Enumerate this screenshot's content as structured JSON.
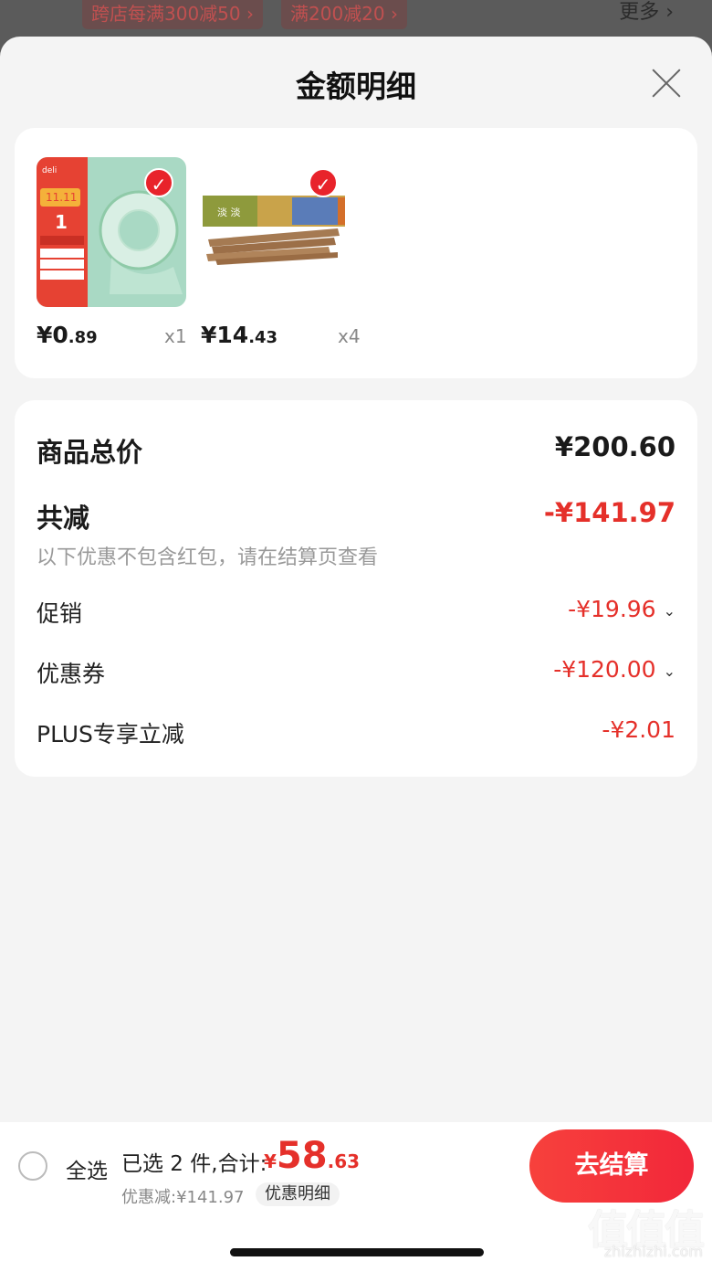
{
  "background": {
    "tags": [
      "跨店每满300减50 ›",
      "满200减20 ›"
    ],
    "more_label": "更多 ›"
  },
  "sheet": {
    "title": "金额明细",
    "close_icon": "close-icon"
  },
  "products": [
    {
      "price_int": "¥0",
      "price_dec": ".89",
      "qty": "x1",
      "selected": true,
      "thumb_icon": "tape-product-image"
    },
    {
      "price_int": "¥14",
      "price_dec": ".43",
      "qty": "x4",
      "selected": true,
      "thumb_icon": "snack-product-image"
    }
  ],
  "summary": {
    "total_label": "商品总价",
    "total_value": "¥200.60",
    "reduce_label": "共减",
    "reduce_value": "-¥141.97",
    "note": "以下优惠不包含红包，请在结算页查看",
    "promo_label": "促销",
    "promo_value": "-¥19.96",
    "coupon_label": "优惠券",
    "coupon_value": "-¥120.00",
    "plus_label": "PLUS专享立减",
    "plus_value": "-¥2.01"
  },
  "bottom": {
    "select_all": "全选",
    "selected_text": "已选 2 件,合计:",
    "total_cur": "¥",
    "total_int": "58",
    "total_dec": ".63",
    "discount_text": "优惠减:¥141.97",
    "detail_link": "优惠明细",
    "checkout": "去结算"
  },
  "watermark": {
    "glyphs": "值值值",
    "url": "zhizhizhi.com"
  },
  "colors": {
    "accent_red": "#e5302a",
    "checkout_red": "#f2273a"
  }
}
